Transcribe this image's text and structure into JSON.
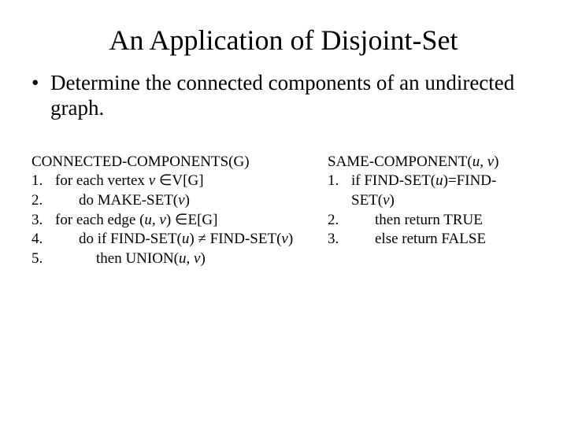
{
  "title": "An Application of Disjoint-Set",
  "bullet": {
    "dot": "•",
    "text": "Determine the connected components of an undirected graph."
  },
  "left": {
    "name": "CONNECTED-COMPONENTS(G)",
    "lines": [
      {
        "n": "1.",
        "pre": "for each vertex ",
        "var": "v",
        "mid": " ∈V[G]",
        "post": ""
      },
      {
        "n": "2.",
        "pre": "do MAKE-SET(",
        "var": "v",
        "mid": "",
        "post": ")"
      },
      {
        "n": "3.",
        "pre": "for each edge (",
        "var": "u, v",
        "mid": ") ∈E[G]",
        "post": ""
      },
      {
        "n": "4.",
        "pre": "do if FIND-SET(",
        "var": "u",
        "mid": ") ≠ FIND-SET(",
        "var2": "v",
        "post": ")"
      },
      {
        "n": "5.",
        "pre": "then UNION(",
        "var": "u, v",
        "mid": "",
        "post": ")"
      }
    ]
  },
  "right": {
    "name_pre": "SAME-COMPONENT(",
    "name_var": "u, v",
    "name_post": ")",
    "lines": [
      {
        "n": "1.",
        "pre": "if FIND-SET(",
        "var": "u",
        "mid": ")=FIND-SET(",
        "var2": "v",
        "post": ")"
      },
      {
        "n": "2.",
        "pre": "then return TRUE"
      },
      {
        "n": "3.",
        "pre": "else return FALSE"
      }
    ]
  }
}
